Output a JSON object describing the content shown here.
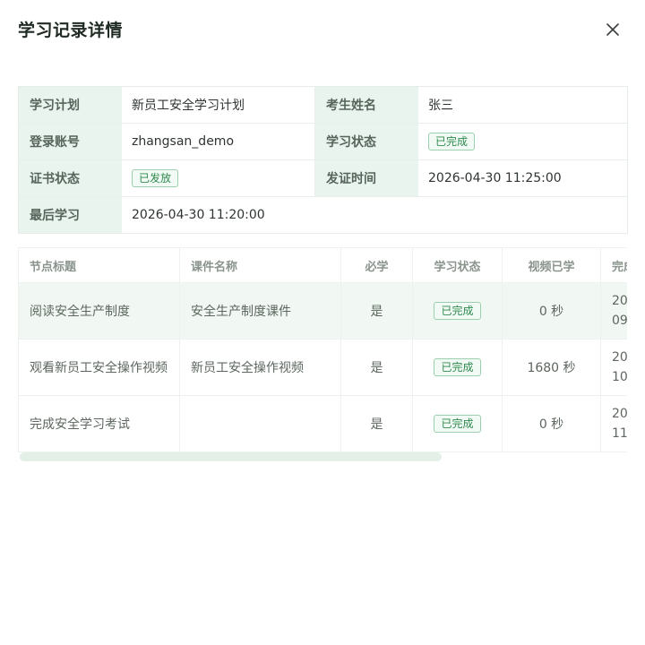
{
  "dialog": {
    "title": "学习记录详情"
  },
  "info": {
    "plan_label": "学习计划",
    "plan_value": "新员工安全学习计划",
    "name_label": "考生姓名",
    "name_value": "张三",
    "account_label": "登录账号",
    "account_value": "zhangsan_demo",
    "status_label": "学习状态",
    "status_value": "已完成",
    "cert_status_label": "证书状态",
    "cert_status_value": "已发放",
    "issue_time_label": "发证时间",
    "issue_time_value": "2026-04-30 11:25:00",
    "last_study_label": "最后学习",
    "last_study_value": "2026-04-30 11:20:00"
  },
  "table": {
    "headers": [
      "节点标题",
      "课件名称",
      "必学",
      "学习状态",
      "视频已学",
      "完成"
    ],
    "rows": [
      {
        "title": "阅读安全生产制度",
        "course": "安全生产制度课件",
        "required": "是",
        "status": "已完成",
        "video": "0 秒",
        "done_line1": "20",
        "done_line2": "09"
      },
      {
        "title": "观看新员工安全操作视频",
        "course": "新员工安全操作视频",
        "required": "是",
        "status": "已完成",
        "video": "1680 秒",
        "done_line1": "20",
        "done_line2": "10"
      },
      {
        "title": "完成安全学习考试",
        "course": "",
        "required": "是",
        "status": "已完成",
        "video": "0 秒",
        "done_line1": "20",
        "done_line2": "11"
      }
    ]
  },
  "colors": {
    "accent_green": "#2f8a4f",
    "label_bg": "#eaf4ee"
  },
  "icons": {
    "close": "close-icon"
  }
}
